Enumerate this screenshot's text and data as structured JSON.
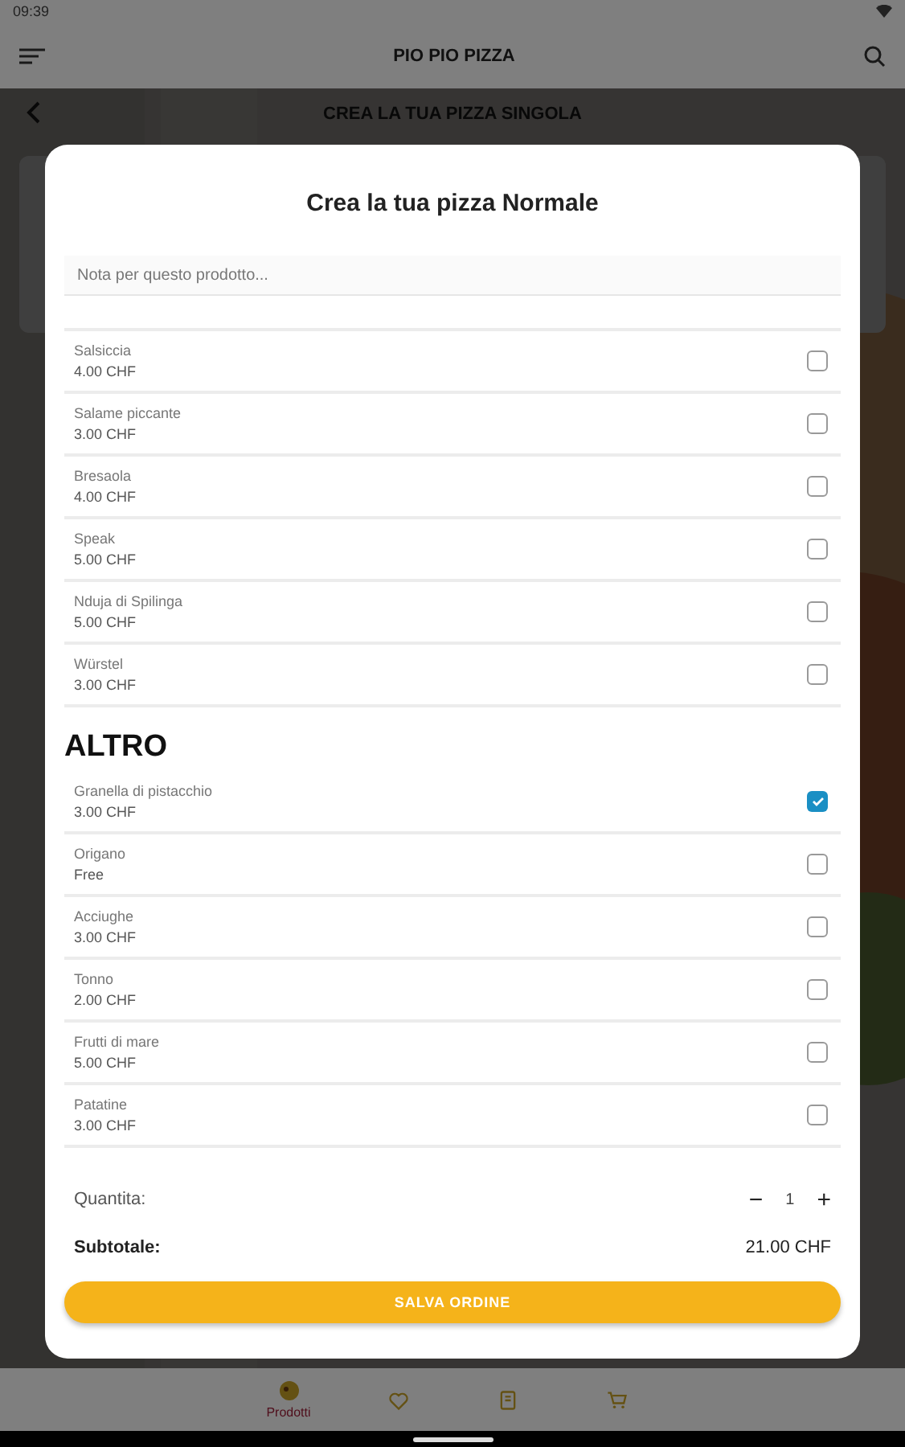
{
  "status_bar": {
    "time": "09:39"
  },
  "app_bar": {
    "title": "PIO PIO PIZZA"
  },
  "page": {
    "title": "CREA LA TUA PIZZA SINGOLA"
  },
  "dialog": {
    "title": "Crea la tua pizza Normale",
    "note": {
      "placeholder": "Nota per questo prodotto..."
    },
    "sections": [
      {
        "items": [
          {
            "name": "Salsiccia",
            "price": "4.00 CHF",
            "checked": false
          },
          {
            "name": "Salame piccante",
            "price": "3.00 CHF",
            "checked": false
          },
          {
            "name": "Bresaola",
            "price": "4.00 CHF",
            "checked": false
          },
          {
            "name": "Speak",
            "price": "5.00 CHF",
            "checked": false
          },
          {
            "name": "Nduja di Spilinga",
            "price": "5.00 CHF",
            "checked": false
          },
          {
            "name": "Würstel",
            "price": "3.00 CHF",
            "checked": false
          }
        ]
      },
      {
        "title": "ALTRO",
        "items": [
          {
            "name": "Granella di pistacchio",
            "price": "3.00 CHF",
            "checked": true
          },
          {
            "name": "Origano",
            "price": "Free",
            "checked": false
          },
          {
            "name": "Acciughe",
            "price": "3.00 CHF",
            "checked": false
          },
          {
            "name": "Tonno",
            "price": "2.00 CHF",
            "checked": false
          },
          {
            "name": "Frutti di mare",
            "price": "5.00 CHF",
            "checked": false
          },
          {
            "name": "Patatine",
            "price": "3.00 CHF",
            "checked": false
          }
        ]
      }
    ],
    "quantity": {
      "label": "Quantita:",
      "minus": "−",
      "value": "1",
      "plus": "+"
    },
    "subtotal": {
      "label": "Subtotale:",
      "value": "21.00 CHF"
    },
    "save_button": "SALVA ORDINE"
  },
  "bottom_nav": [
    {
      "kind": "products",
      "label": "Prodotti",
      "selected": true
    },
    {
      "kind": "favorites",
      "selected": false
    },
    {
      "kind": "menu",
      "selected": false
    },
    {
      "kind": "cart",
      "selected": false
    }
  ]
}
